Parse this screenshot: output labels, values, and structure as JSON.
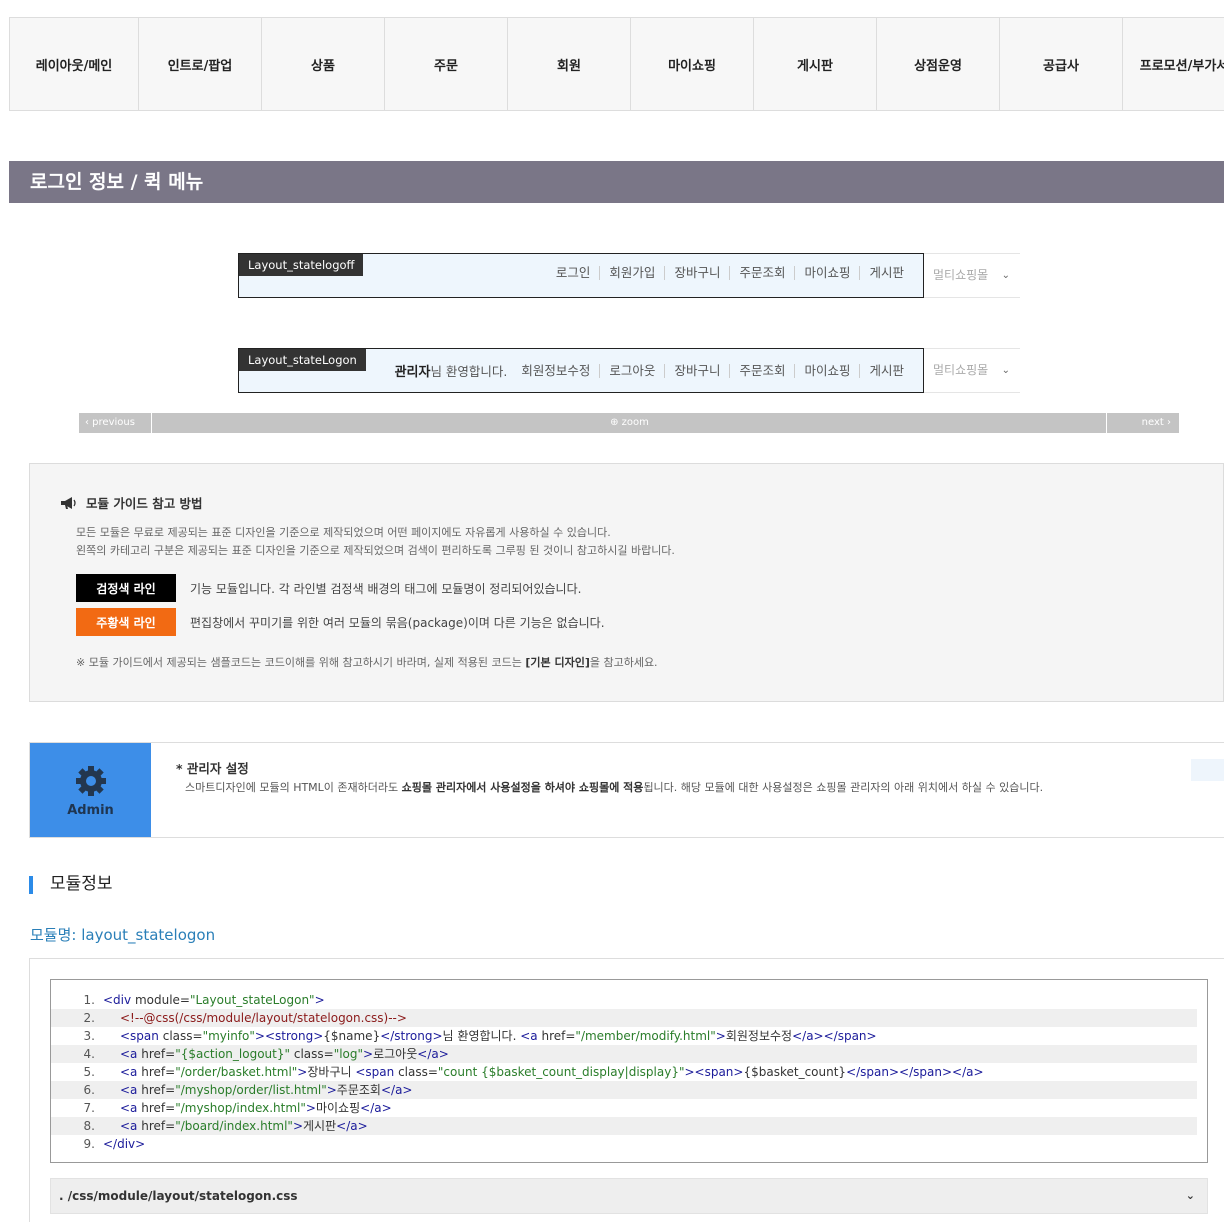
{
  "nav": {
    "tabs": [
      "레이아웃/메인",
      "인트로/팝업",
      "상품",
      "주문",
      "회원",
      "마이쇼핑",
      "게시판",
      "상점운영",
      "공급사",
      "프로모션/부가서"
    ]
  },
  "section_title": "로그인 정보 / 퀵 메뉴",
  "statelogoff": {
    "tag": "Layout_statelogoff",
    "links": [
      "로그인",
      "회원가입",
      "장바구니",
      "주문조회",
      "마이쇼핑",
      "게시판"
    ],
    "multishop": "멀티쇼핑몰"
  },
  "statelogon": {
    "tag": "Layout_stateLogon",
    "greeting_name": "관리자",
    "greeting_suffix": "님 환영합니다.",
    "links": [
      "회원정보수정",
      "로그아웃",
      "장바구니",
      "주문조회",
      "마이쇼핑",
      "게시판"
    ],
    "multishop": "멀티쇼핑몰"
  },
  "pager": {
    "prev": "‹  previous",
    "zoom": "zoom",
    "next": "next  ›"
  },
  "guide": {
    "title": "모듈 가이드 참고 방법",
    "desc1": "모든 모듈은 무료로 제공되는 표준 디자인을 기준으로 제작되었으며 어떤 페이지에도 자유롭게 사용하실 수 있습니다.",
    "desc2": "왼쪽의 카테고리 구분은 제공되는 표준 디자인을 기준으로 제작되었으며 검색이 편리하도록 그루핑 된 것이니 참고하시길 바랍니다.",
    "black_badge": "검정색 라인",
    "black_text": "기능 모듈입니다. 각 라인별 검정색 배경의 태그에 모듈명이 정리되어있습니다.",
    "orange_badge": "주황색 라인",
    "orange_text": "편집창에서 꾸미기를 위한 여러 모듈의 묶음(package)이며 다른 기능은 없습니다.",
    "note_pre": "※ 모듈 가이드에서 제공되는 샘플코드는 코드이해를 위해 참고하시기 바라며, 실제 적용된 코드는 ",
    "note_bold": "[기본 디자인]",
    "note_post": "을 참고하세요.",
    "colors": {
      "black": "#000000",
      "orange": "#f26a13"
    }
  },
  "admin": {
    "label": "Admin",
    "heading": "* 관리자 설정",
    "text_pre": "스마트디자인에 모듈의 HTML이 존재하더라도 ",
    "text_bold": "쇼핑몰 관리자에서 사용설정을 하셔야 쇼핑몰에 적용",
    "text_post": "됩니다. 해당 모듈에 대한 사용설정은 쇼핑몰 관리자의 아래 위치에서 하실 수 있습니다.",
    "color": "#3d8ee8"
  },
  "module_info": {
    "title": "모듈정보",
    "name": "모듈명: layout_statelogon"
  },
  "code": {
    "numbers": [
      "1.",
      "2.",
      "3.",
      "4.",
      "5.",
      "6.",
      "7.",
      "8.",
      "9."
    ]
  },
  "css_file": ". /css/module/layout/statelogon.css"
}
